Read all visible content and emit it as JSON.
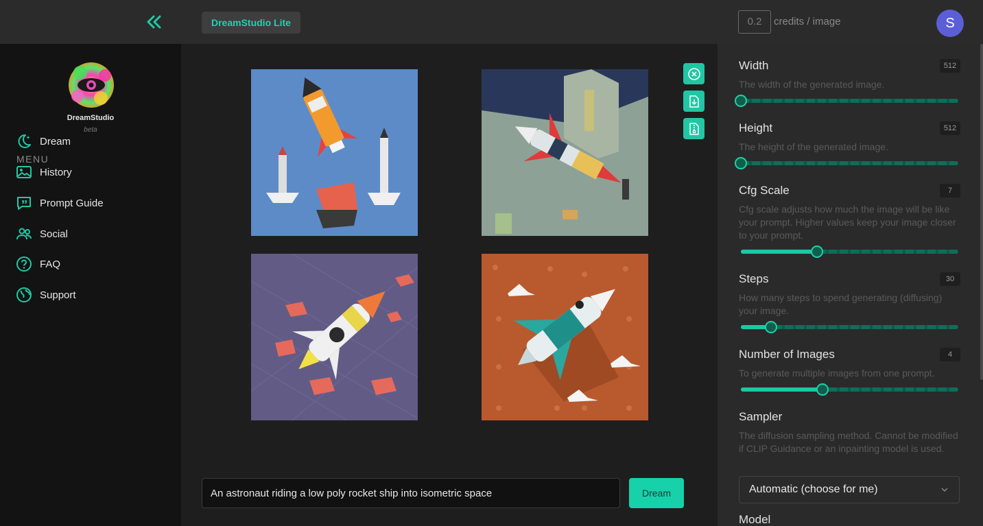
{
  "app": {
    "badge": "DreamStudio Lite",
    "brand": "DreamStudio",
    "brand_sub": "beta",
    "credits_value": "0.2",
    "credits_label": "credits / image",
    "avatar_letter": "S",
    "accent": "#1fc9a5"
  },
  "sidebar": {
    "menu_label": "MENU",
    "items": [
      {
        "label": "Dream",
        "icon": "moon-sparkle-icon"
      },
      {
        "label": "History",
        "icon": "image-gallery-icon"
      },
      {
        "label": "Prompt Guide",
        "icon": "chat-quote-icon"
      },
      {
        "label": "Social",
        "icon": "users-icon"
      },
      {
        "label": "FAQ",
        "icon": "question-circle-icon"
      },
      {
        "label": "Support",
        "icon": "globe-support-icon"
      }
    ]
  },
  "main": {
    "prompt_value": "An astronaut riding a low poly rocket ship into isometric space",
    "dream_label": "Dream",
    "image_actions": [
      "close-circle-icon",
      "download-file-icon",
      "zip-file-icon"
    ]
  },
  "settings": {
    "width": {
      "title": "Width",
      "value": "512",
      "desc": "The width of the generated image.",
      "fraction": 0.0
    },
    "height": {
      "title": "Height",
      "value": "512",
      "desc": "The height of the generated image.",
      "fraction": 0.0
    },
    "cfg": {
      "title": "Cfg Scale",
      "value": "7",
      "desc": "Cfg scale adjusts how much the image will be like your prompt. Higher values keep your image closer to your prompt.",
      "fraction": 0.35
    },
    "steps": {
      "title": "Steps",
      "value": "30",
      "desc": "How many steps to spend generating (diffusing) your image.",
      "fraction": 0.14
    },
    "num_images": {
      "title": "Number of Images",
      "value": "4",
      "desc": "To generate multiple images from one prompt.",
      "fraction": 0.375
    },
    "sampler": {
      "title": "Sampler",
      "desc": "The diffusion sampling method. Cannot be modified if CLIP Guidance or an inpainting model is used.",
      "selected": "Automatic (choose for me)"
    },
    "model": {
      "title": "Model"
    }
  }
}
